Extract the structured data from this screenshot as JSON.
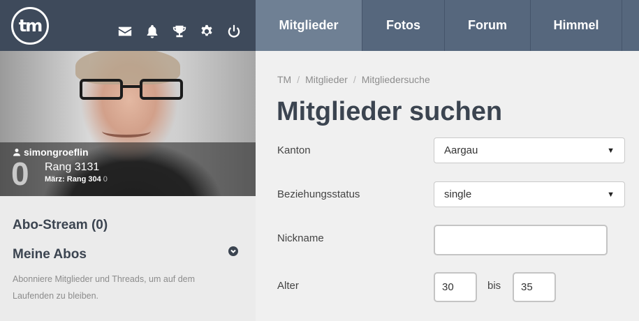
{
  "sidebar": {
    "logo_text": "tm",
    "icons": [
      "envelope-icon",
      "bell-icon",
      "trophy-icon",
      "gear-icon",
      "power-icon"
    ],
    "profile": {
      "username": "simongroeflin",
      "points": "0",
      "rank": "Rang 3131",
      "month_label": "März:",
      "month_rank": "Rang 304",
      "month_points": "0"
    },
    "abo_stream": "Abo-Stream (0)",
    "meine_abos": "Meine Abos",
    "abos_description": "Abonniere Mitglieder und Threads, um auf dem Laufenden zu bleiben."
  },
  "nav": {
    "tabs": [
      {
        "label": "Mitglieder",
        "active": true
      },
      {
        "label": "Fotos",
        "active": false
      },
      {
        "label": "Forum",
        "active": false
      },
      {
        "label": "Himmel",
        "active": false
      }
    ]
  },
  "breadcrumb": [
    "TM",
    "Mitglieder",
    "Mitgliedersuche"
  ],
  "page_title": "Mitglieder suchen",
  "form": {
    "kanton_label": "Kanton",
    "kanton_value": "Aargau",
    "beziehung_label": "Beziehungsstatus",
    "beziehung_value": "single",
    "nickname_label": "Nickname",
    "nickname_value": "",
    "alter_label": "Alter",
    "alter_from": "30",
    "alter_bis": "bis",
    "alter_to": "35"
  },
  "colors": {
    "header_dark": "#3e4a5b",
    "nav_bg": "#56677d",
    "nav_active": "#6f8094",
    "title": "#3b4450"
  }
}
